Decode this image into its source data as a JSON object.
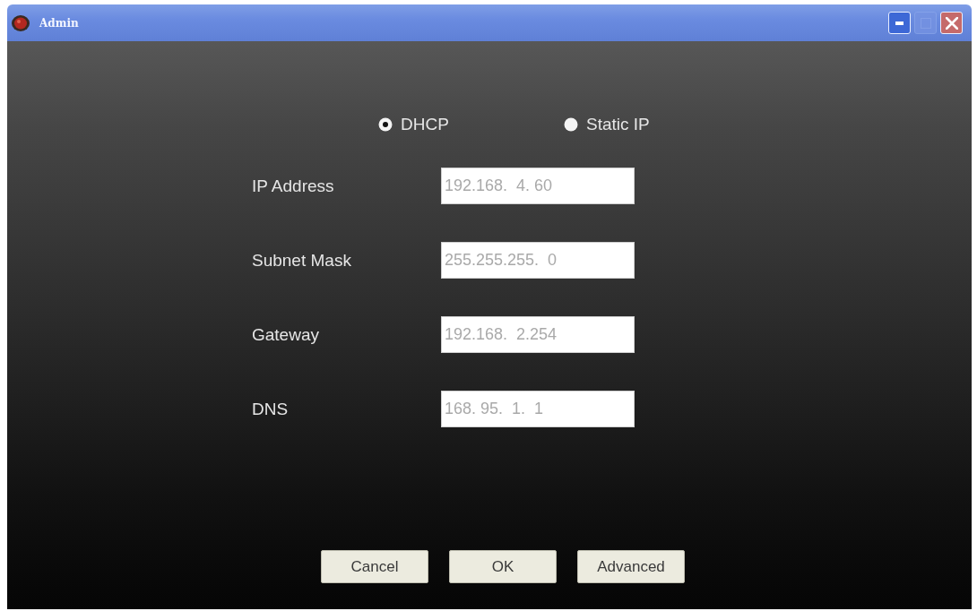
{
  "window": {
    "title": "Admin",
    "controls": [
      {
        "kind": "minimize",
        "disabled": false
      },
      {
        "kind": "maximize",
        "disabled": true
      },
      {
        "kind": "close",
        "disabled": false
      }
    ]
  },
  "mode": [
    {
      "label": "DHCP",
      "selected": true
    },
    {
      "label": "Static IP",
      "selected": false
    }
  ],
  "fields": [
    {
      "label": "IP Address",
      "value": "192.168.  4. 60",
      "disabled": true
    },
    {
      "label": "Subnet Mask",
      "value": "255.255.255.  0",
      "disabled": true
    },
    {
      "label": "Gateway",
      "value": "192.168.  2.254",
      "disabled": true
    },
    {
      "label": "DNS",
      "value": "168. 95.  1.  1",
      "disabled": true
    }
  ],
  "buttons": [
    "Cancel",
    "OK",
    "Advanced"
  ]
}
